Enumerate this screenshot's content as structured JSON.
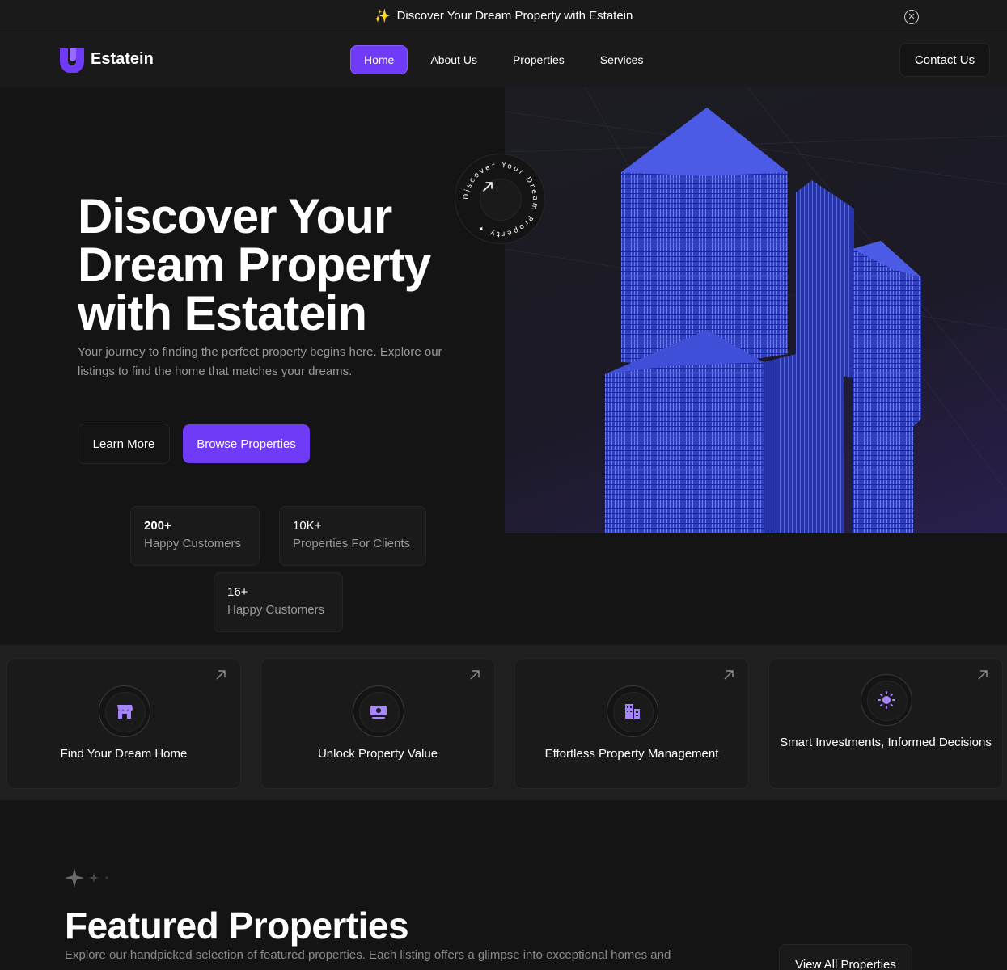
{
  "banner": {
    "text": "Discover Your Dream Property with Estatein",
    "spark_icon": "sparkles-icon",
    "close_icon": "close-circle-icon"
  },
  "header": {
    "logo_text": "Estatein",
    "nav": [
      {
        "label": "Home",
        "active": true
      },
      {
        "label": "About Us",
        "active": false
      },
      {
        "label": "Properties",
        "active": false
      },
      {
        "label": "Services",
        "active": false
      }
    ],
    "contact_label": "Contact Us"
  },
  "hero": {
    "title": "Discover Your Dream Property with Estatein",
    "subtitle": "Your journey to finding the perfect property begins here. Explore our listings to find the home that matches your dreams.",
    "learn_more": "Learn More",
    "browse": "Browse Properties",
    "badge_text": "Discover Your Dream Property ✦ ",
    "stats": [
      {
        "number": "200+",
        "label": "Happy Customers"
      },
      {
        "number": "10K+",
        "label": "Properties For Clients"
      },
      {
        "number": "16+",
        "label": "Happy Customers"
      }
    ]
  },
  "features": [
    {
      "title": "Find Your Dream Home",
      "icon": "storefront-icon"
    },
    {
      "title": "Unlock Property Value",
      "icon": "cash-icon"
    },
    {
      "title": "Effortless Property Management",
      "icon": "buildings-icon"
    },
    {
      "title": "Smart Investments, Informed Decisions",
      "icon": "sun-icon"
    }
  ],
  "featured": {
    "title": "Featured Properties",
    "subtitle": "Explore our handpicked selection of featured properties. Each listing offers a glimpse into exceptional homes and",
    "view_all": "View All Properties"
  },
  "colors": {
    "accent": "#703bf7",
    "background": "#141414",
    "surface": "#1a1a1a",
    "border": "#262626",
    "muted_text": "#999999"
  }
}
